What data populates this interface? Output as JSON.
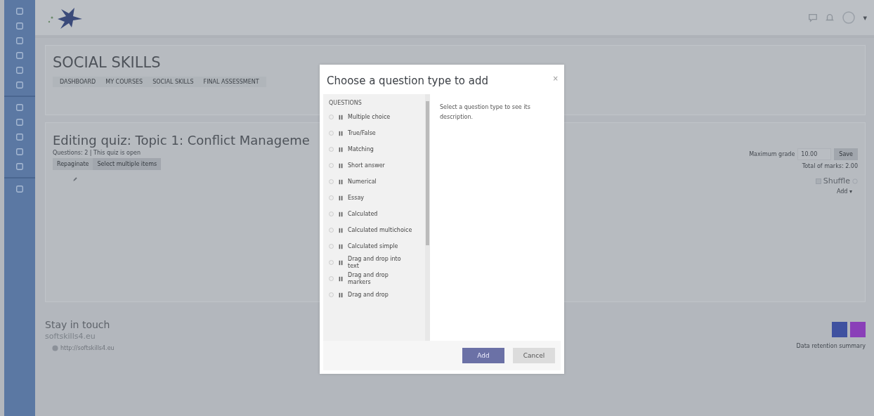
{
  "header": {
    "user_menu_caret": "▾"
  },
  "course": {
    "title": "SOCIAL SKILLS",
    "breadcrumbs": [
      {
        "label": "DASHBOARD"
      },
      {
        "label": "MY COURSES"
      },
      {
        "label": "SOCIAL SKILLS"
      },
      {
        "label": "FINAL ASSESSMENT"
      }
    ]
  },
  "quiz": {
    "title": "Editing quiz: Topic 1: Conflict Manageme",
    "status": "Questions: 2 | This quiz is open",
    "buttons": [
      "Repaginate",
      "Select multiple items"
    ],
    "max_grade_label": "Maximum grade",
    "max_grade_value": "10.00",
    "save": "Save",
    "total": "Total of marks: 2.00",
    "shuffle": "Shuffle",
    "shuffle_checked": false,
    "add": "Add ▾"
  },
  "footer": {
    "heading": "Stay in touch",
    "site": "softskills4.eu",
    "link": "http://softskills4.eu",
    "socials": [
      {
        "color": "#3f51a0"
      },
      {
        "color": "#8a3fb8"
      }
    ],
    "data_retention": "Data retention summary"
  },
  "modal": {
    "title": "Choose a question type to add",
    "close": "×",
    "section": "QUESTIONS",
    "description": "Select a question type to see its description.",
    "options": [
      {
        "label": "Multiple choice",
        "selected": false
      },
      {
        "label": "True/False",
        "selected": false
      },
      {
        "label": "Matching",
        "selected": false
      },
      {
        "label": "Short answer",
        "selected": false
      },
      {
        "label": "Numerical",
        "selected": false
      },
      {
        "label": "Essay",
        "selected": false
      },
      {
        "label": "Calculated",
        "selected": false
      },
      {
        "label": "Calculated multichoice",
        "selected": false
      },
      {
        "label": "Calculated simple",
        "selected": false
      },
      {
        "label": "Drag and drop into text",
        "selected": false
      },
      {
        "label": "Drag and drop markers",
        "selected": false
      },
      {
        "label": "Drag and drop",
        "selected": false
      }
    ],
    "buttons": [
      {
        "label": "Add",
        "kind": "primary"
      },
      {
        "label": "Cancel",
        "kind": "secondary"
      }
    ]
  }
}
